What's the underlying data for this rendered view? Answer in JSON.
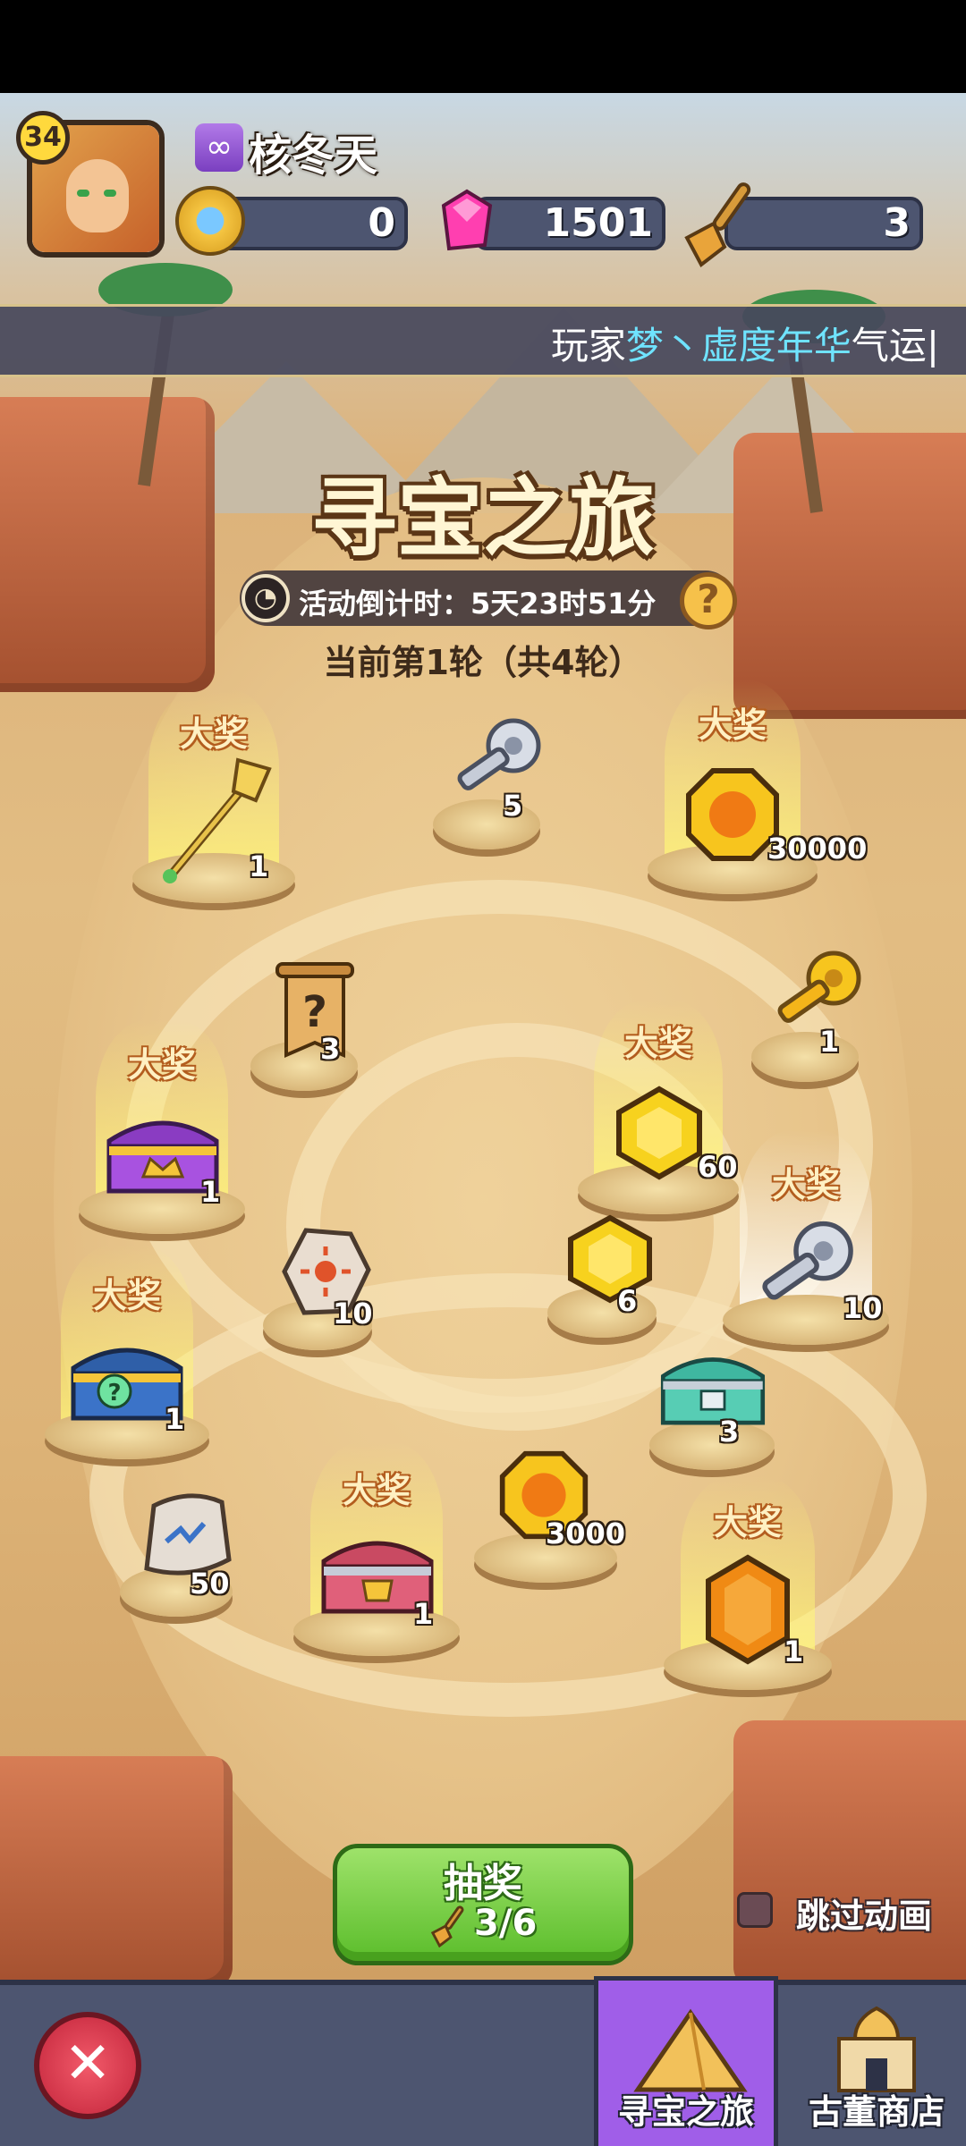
{
  "player": {
    "level": "34",
    "vip_icon": "infinity-vip-icon",
    "name": "核冬天"
  },
  "resources": {
    "coin": "0",
    "gem": "1501",
    "shovel": "3"
  },
  "marquee": {
    "prefix": "玩家",
    "player_name": "梦丶虚度年华",
    "suffix": "气运|"
  },
  "event": {
    "title": "寻宝之旅",
    "countdown": "活动倒计时：5天23时51分",
    "round": "当前第1轮（共4轮）"
  },
  "grand_prize_label": "大奖",
  "rewards": [
    {
      "item": "golden-spear-icon",
      "qty": "1",
      "grand": true
    },
    {
      "item": "silver-key-icon",
      "qty": "5",
      "grand": false
    },
    {
      "item": "gold-coin-icon",
      "qty": "30000",
      "grand": true
    },
    {
      "item": "mystery-scroll-icon",
      "qty": "3",
      "grand": false
    },
    {
      "item": "gold-key-icon",
      "qty": "1",
      "grand": false
    },
    {
      "item": "royal-chest-icon",
      "qty": "1",
      "grand": true
    },
    {
      "item": "gold-gem-icon",
      "qty": "60",
      "grand": true
    },
    {
      "item": "sun-rune-stone-icon",
      "qty": "10",
      "grand": false
    },
    {
      "item": "gold-gem-icon",
      "qty": "6",
      "grand": false
    },
    {
      "item": "silver-key-icon",
      "qty": "10",
      "grand": true
    },
    {
      "item": "mystery-chest-icon",
      "qty": "1",
      "grand": true
    },
    {
      "item": "teal-chest-icon",
      "qty": "3",
      "grand": false
    },
    {
      "item": "rune-stone-icon",
      "qty": "50",
      "grand": false
    },
    {
      "item": "gold-coin-icon",
      "qty": "3000",
      "grand": false
    },
    {
      "item": "armor-chest-icon",
      "qty": "1",
      "grand": true
    },
    {
      "item": "amber-gem-icon",
      "qty": "1",
      "grand": true
    }
  ],
  "draw": {
    "label": "抽奖",
    "count": "3/6"
  },
  "skip_animation": {
    "label": "跳过动画",
    "checked": false
  },
  "tabs": [
    {
      "label": "寻宝之旅",
      "active": true
    },
    {
      "label": "古董商店",
      "active": false
    }
  ],
  "colors": {
    "accent_green": "#5bbd2b",
    "tab_active": "#a05ee8",
    "marquee_highlight": "#6fe3ff"
  }
}
